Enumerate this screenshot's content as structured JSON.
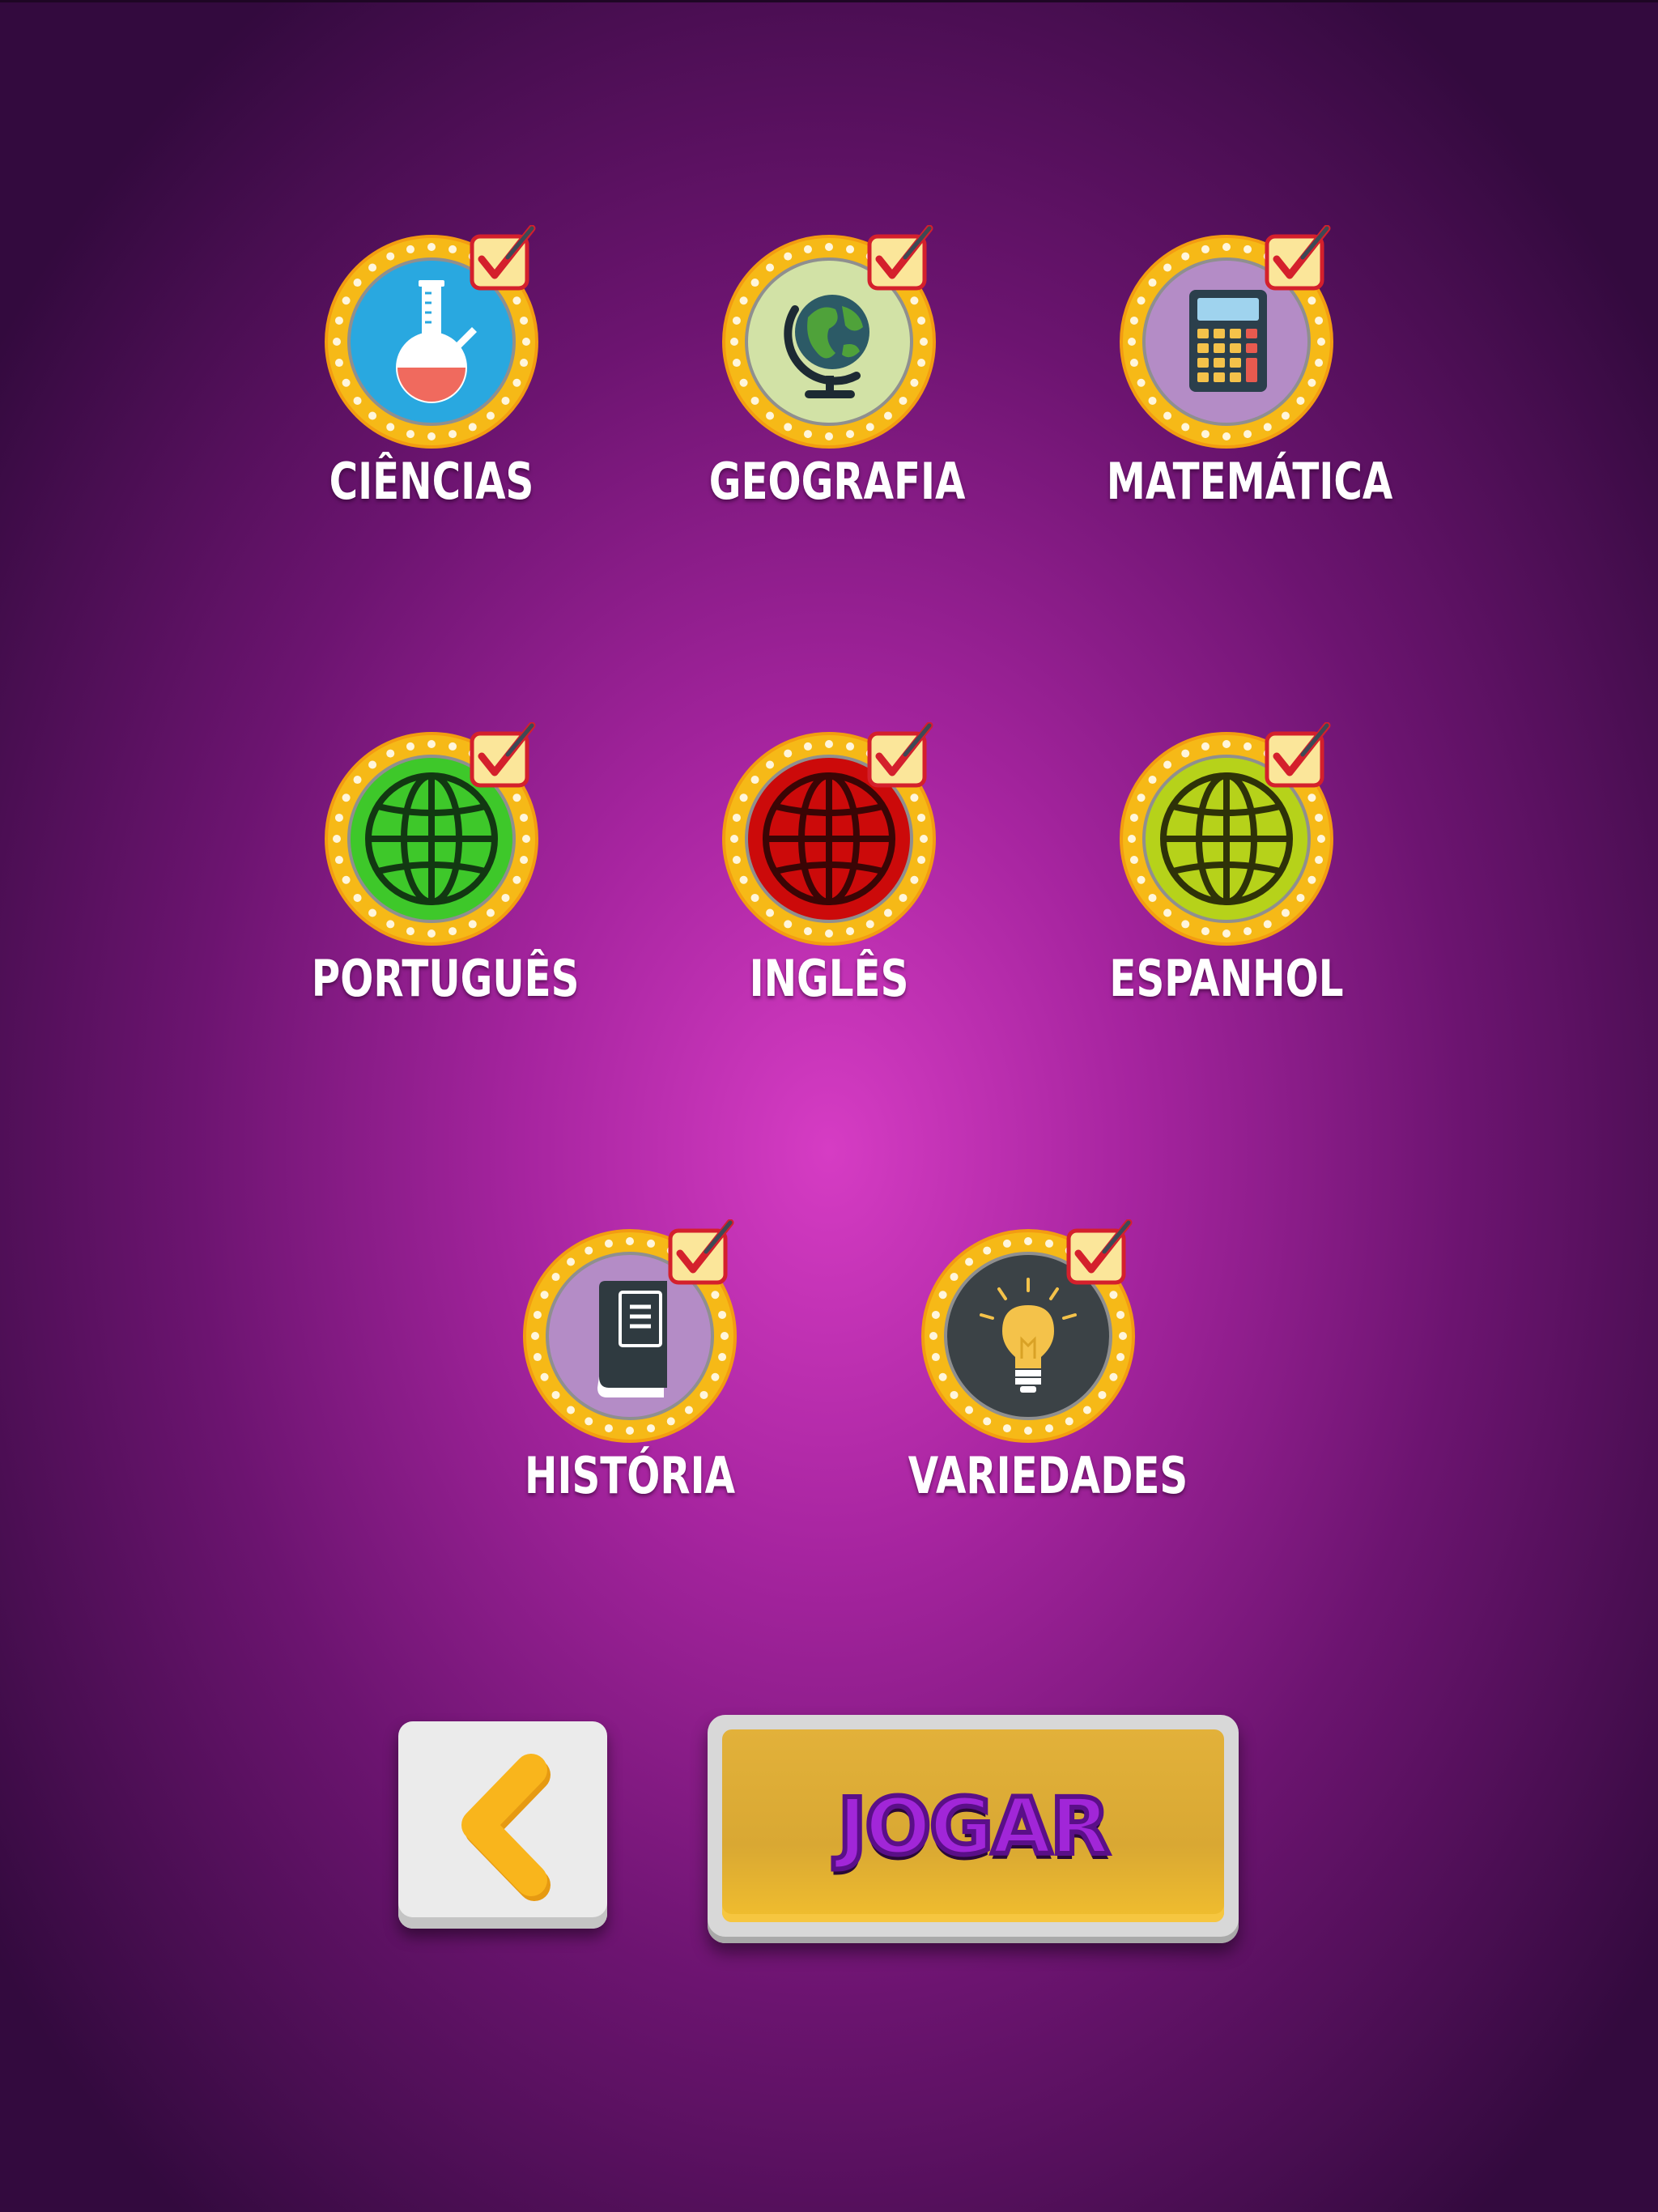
{
  "categories": [
    {
      "label": "CIÊNCIAS",
      "icon": "flask-icon",
      "bg": "#29a8e0",
      "checked": true
    },
    {
      "label": "GEOGRAFIA",
      "icon": "globe-icon",
      "bg": "#d2e2a6",
      "checked": true
    },
    {
      "label": "MATEMÁTICA",
      "icon": "calculator-icon",
      "bg": "#b48cc6",
      "checked": true
    },
    {
      "label": "PORTUGUÊS",
      "icon": "world-icon",
      "bg": "#3ec82a",
      "checked": true
    },
    {
      "label": "INGLÊS",
      "icon": "world-icon",
      "bg": "#cc0a0a",
      "checked": true
    },
    {
      "label": "ESPANHOL",
      "icon": "world-icon",
      "bg": "#b6d21a",
      "checked": true
    },
    {
      "label": "HISTÓRIA",
      "icon": "book-icon",
      "bg": "#b48cc6",
      "checked": true
    },
    {
      "label": "VARIEDADES",
      "icon": "lightbulb-icon",
      "bg": "#3b4246",
      "checked": true
    }
  ],
  "buttons": {
    "back": {
      "icon": "chevron-left-icon"
    },
    "play": {
      "label": "JOGAR"
    }
  },
  "colors": {
    "ring": "#f6b917",
    "check": "#d4202c",
    "play_button": "#dcaa34",
    "play_text": "#a126d8",
    "back_arrow": "#f9b51c"
  }
}
